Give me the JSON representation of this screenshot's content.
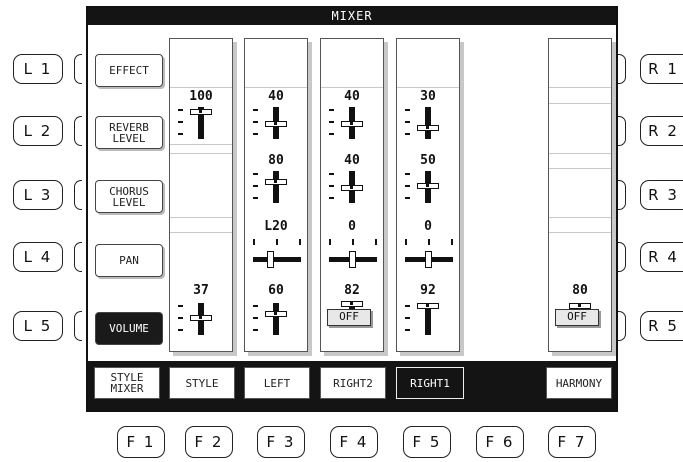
{
  "screen": {
    "title": "MIXER"
  },
  "left_buttons": [
    {
      "id": "L 1",
      "label": "EFFECT",
      "selected": false
    },
    {
      "id": "L 2",
      "label": "REVERB\nLEVEL",
      "selected": false
    },
    {
      "id": "L 3",
      "label": "CHORUS\nLEVEL",
      "selected": false
    },
    {
      "id": "L 4",
      "label": "PAN",
      "selected": false
    },
    {
      "id": "L 5",
      "label": "VOLUME",
      "selected": true
    }
  ],
  "right_buttons": [
    "R 1",
    "R 2",
    "R 3",
    "R 4",
    "R 5"
  ],
  "bottom_buttons": [
    "F 1",
    "F 2",
    "F 3",
    "F 4",
    "F 5",
    "F 6",
    "F 7"
  ],
  "parts": [
    {
      "name": "STYLE MIXER",
      "selected": false,
      "reverb": "100",
      "chorus": "",
      "pan": "",
      "volume": "37",
      "volume_off": false
    },
    {
      "name": "STYLE",
      "selected": false,
      "reverb": "40",
      "chorus": "80",
      "pan": "L20",
      "volume": "60",
      "volume_off": false
    },
    {
      "name": "LEFT",
      "selected": false,
      "reverb": "40",
      "chorus": "40",
      "pan": "0",
      "volume": "82",
      "volume_off": true
    },
    {
      "name": "RIGHT2",
      "selected": false,
      "reverb": "30",
      "chorus": "50",
      "pan": "0",
      "volume": "92",
      "volume_off": false
    },
    {
      "name": "RIGHT1",
      "selected": true
    },
    {
      "name": "",
      "selected": false
    },
    {
      "name": "HARMONY",
      "selected": false,
      "volume": "80",
      "volume_off": true
    }
  ],
  "off_label": "OFF"
}
